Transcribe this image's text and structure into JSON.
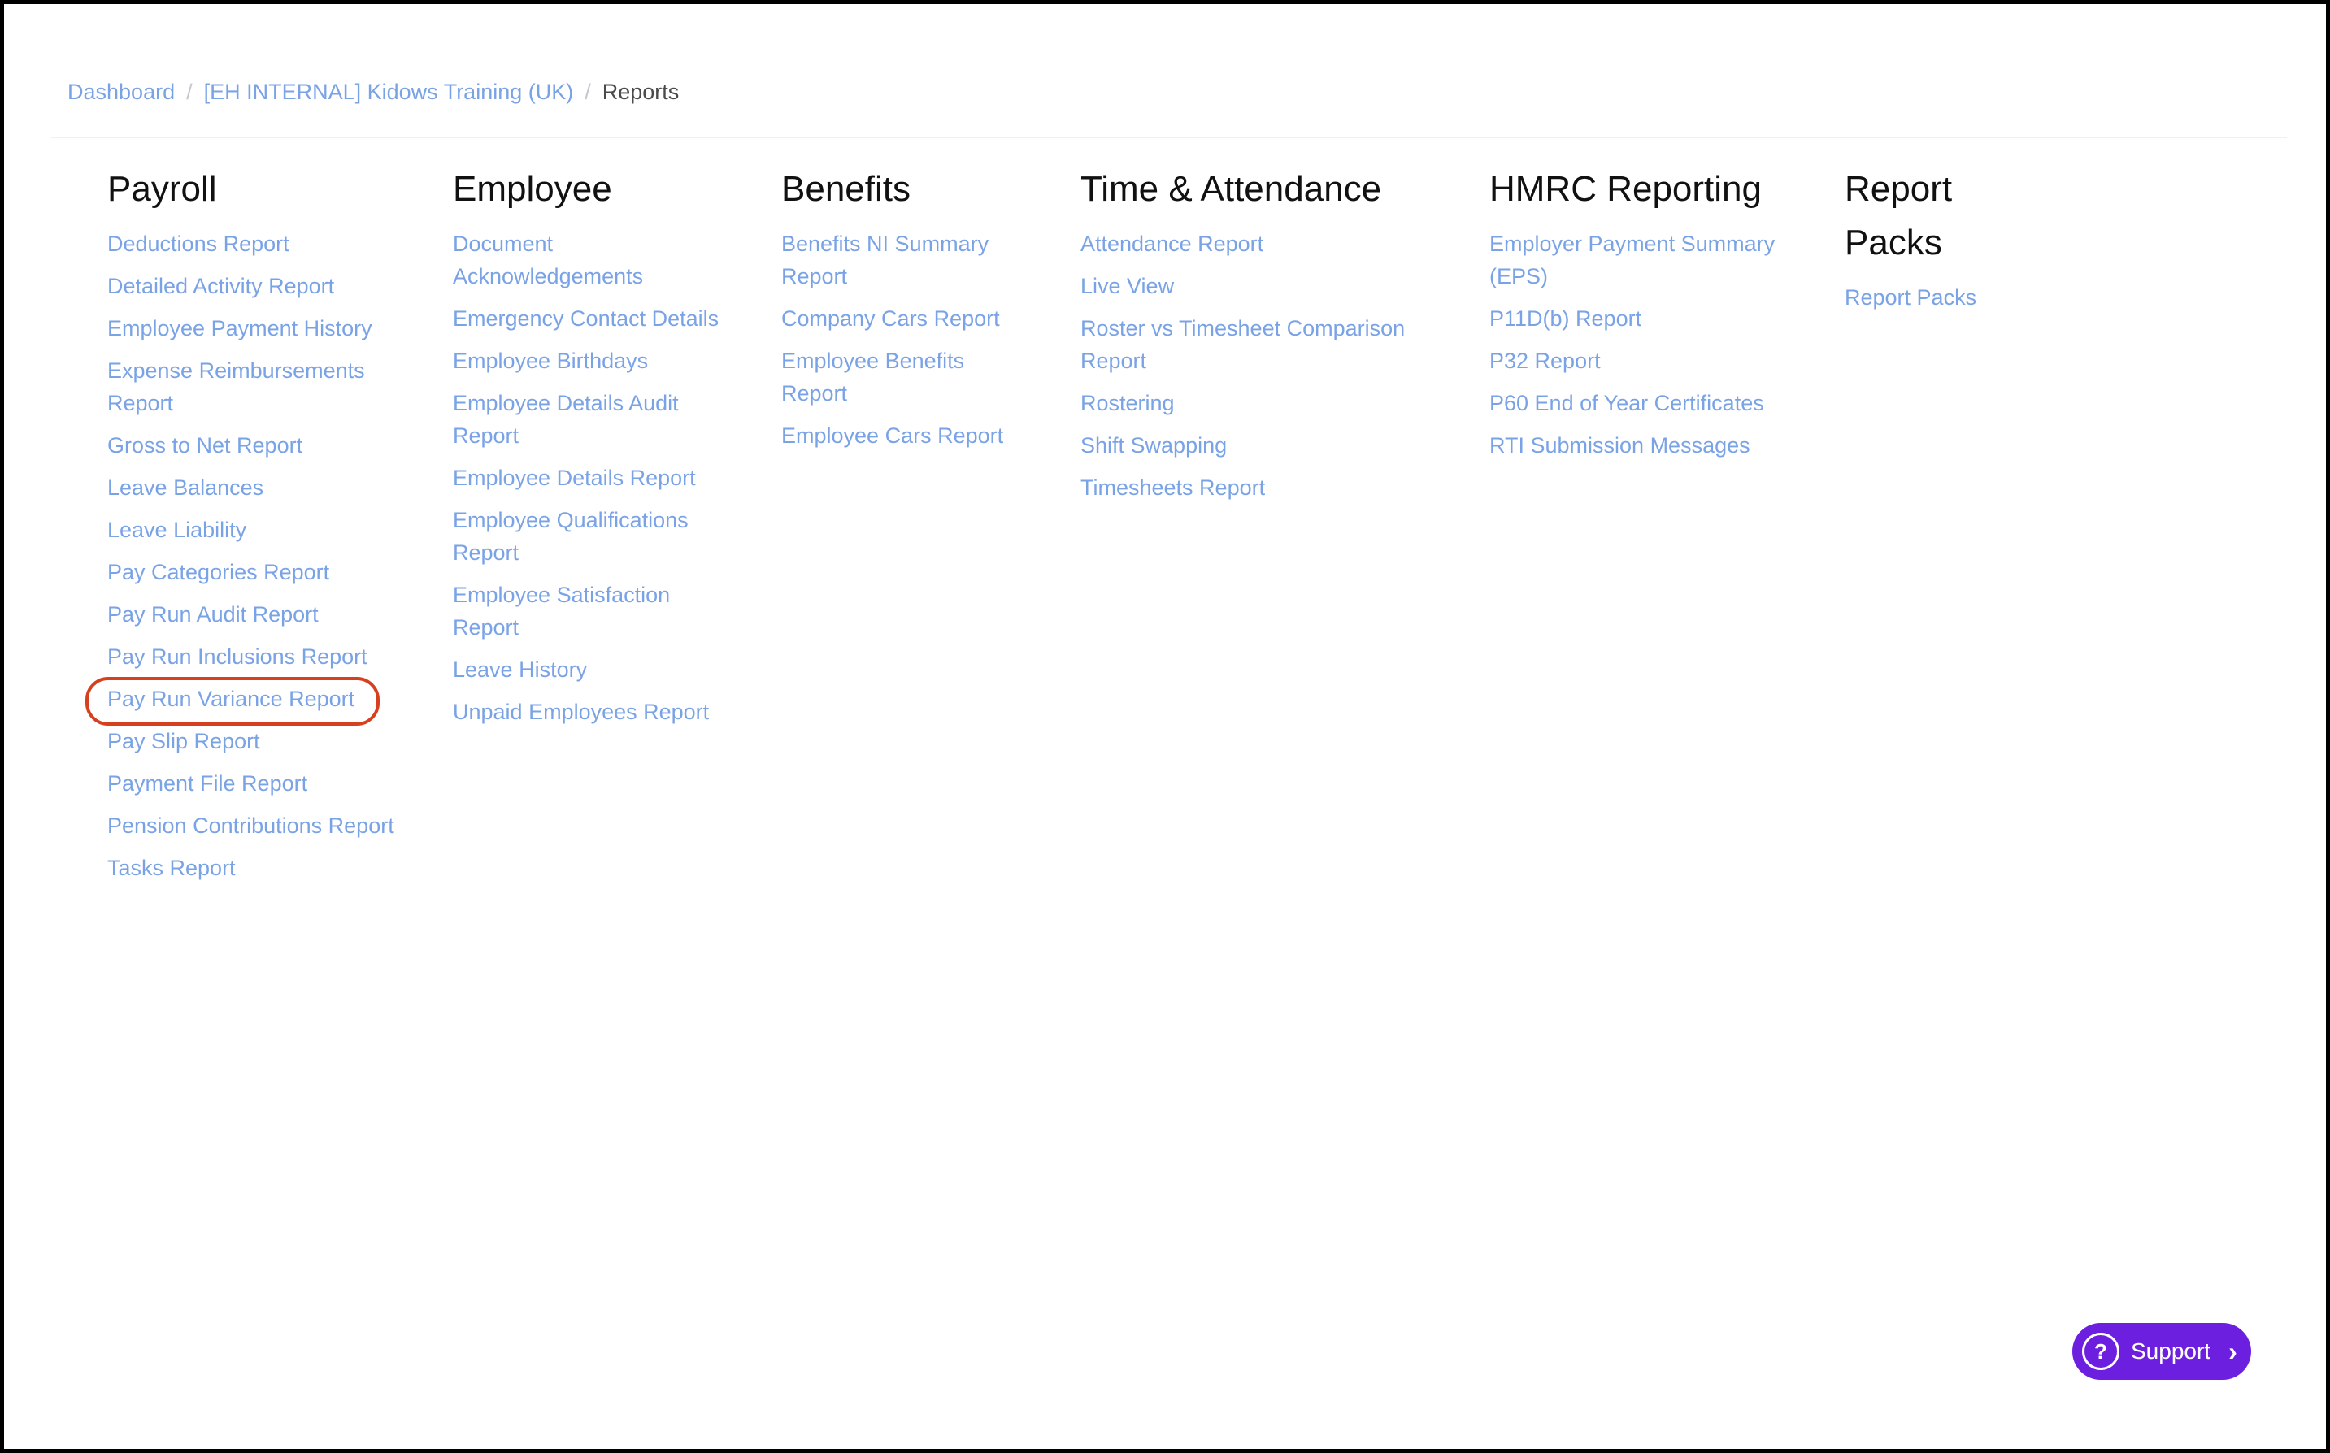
{
  "breadcrumb": {
    "items": [
      "Dashboard",
      "[EH INTERNAL] Kidows Training (UK)"
    ],
    "current": "Reports",
    "separator": "/"
  },
  "columns": [
    {
      "heading": "Payroll",
      "links": [
        "Deductions Report",
        "Detailed Activity Report",
        "Employee Payment History",
        "Expense Reimbursements Report",
        "Gross to Net Report",
        "Leave Balances",
        "Leave Liability",
        "Pay Categories Report",
        "Pay Run Audit Report",
        "Pay Run Inclusions Report",
        "Pay Run Variance Report",
        "Pay Slip Report",
        "Payment File Report",
        "Pension Contributions Report",
        "Tasks Report"
      ]
    },
    {
      "heading": "Employee",
      "links": [
        "Document Acknowledgements",
        "Emergency Contact Details",
        "Employee Birthdays",
        "Employee Details Audit Report",
        "Employee Details Report",
        "Employee Qualifications Report",
        "Employee Satisfaction Report",
        "Leave History",
        "Unpaid Employees Report"
      ]
    },
    {
      "heading": "Benefits",
      "links": [
        "Benefits NI Summary Report",
        "Company Cars Report",
        "Employee Benefits Report",
        "Employee Cars Report"
      ]
    },
    {
      "heading": "Time & Attendance",
      "links": [
        "Attendance Report",
        "Live View",
        "Roster vs Timesheet Comparison Report",
        "Rostering",
        "Shift Swapping",
        "Timesheets Report"
      ]
    },
    {
      "heading": "HMRC Reporting",
      "links": [
        "Employer Payment Summary (EPS)",
        "P11D(b) Report",
        "P32 Report",
        "P60 End of Year Certificates",
        "RTI Submission Messages"
      ]
    },
    {
      "heading": "Report Packs",
      "links": [
        "Report Packs"
      ]
    }
  ],
  "highlight": {
    "column": "Payroll",
    "link": "Pay Run Variance Report",
    "color": "#d6401e"
  },
  "support": {
    "label": "Support",
    "icon": "question-circle-icon",
    "chevron": "chevron-right-icon"
  },
  "colors": {
    "link": "#7aa3e6",
    "heading": "#111111",
    "accent": "#6d1fe0"
  }
}
